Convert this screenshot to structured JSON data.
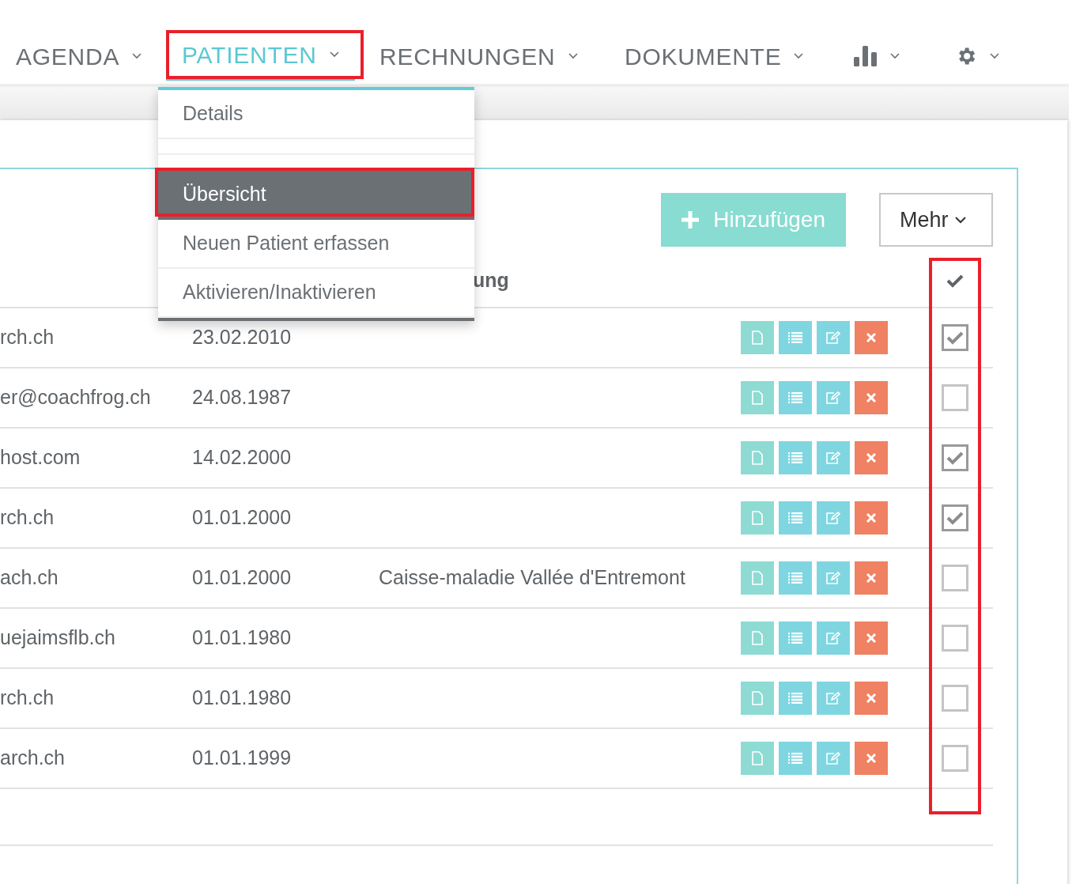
{
  "nav": [
    {
      "kind": "text",
      "label": "AGENDA",
      "selected": false,
      "highlighted": false
    },
    {
      "kind": "text",
      "label": "PATIENTEN",
      "selected": true,
      "highlighted": true
    },
    {
      "kind": "text",
      "label": "RECHNUNGEN",
      "selected": false,
      "highlighted": false
    },
    {
      "kind": "text",
      "label": "DOKUMENTE",
      "selected": false,
      "highlighted": false
    },
    {
      "kind": "chart",
      "selected": false,
      "highlighted": false
    },
    {
      "kind": "gear",
      "selected": false,
      "highlighted": false
    }
  ],
  "dropdown": {
    "items": [
      {
        "kind": "item",
        "label": "Details",
        "selected": false,
        "highlighted": false
      },
      {
        "kind": "blank",
        "selected": false,
        "highlighted": false
      },
      {
        "kind": "blank",
        "selected": false,
        "highlighted": false
      },
      {
        "kind": "item",
        "label": "Übersicht",
        "selected": true,
        "highlighted": true
      },
      {
        "kind": "item",
        "label": "Neuen Patient erfassen",
        "selected": false,
        "highlighted": false
      },
      {
        "kind": "item",
        "label": "Aktivieren/Inaktivieren",
        "selected": false,
        "highlighted": false
      }
    ]
  },
  "toolbar": {
    "add_button": "Hinzufügen",
    "more_button": "Mehr"
  },
  "table": {
    "column_3_header": "ung",
    "checkbox_column_highlighted": true,
    "rows": [
      {
        "column_1": "rch.ch",
        "date": "23.02.2010",
        "column_3": "",
        "checked": true
      },
      {
        "column_1": "er@coachfrog.ch",
        "date": "24.08.1987",
        "column_3": "",
        "checked": false
      },
      {
        "column_1": "host.com",
        "date": "14.02.2000",
        "column_3": "",
        "checked": true
      },
      {
        "column_1": "rch.ch",
        "date": "01.01.2000",
        "column_3": "",
        "checked": true
      },
      {
        "column_1": "ach.ch",
        "date": "01.01.2000",
        "column_3": "Caisse-maladie Vallée d'Entremont",
        "checked": false
      },
      {
        "column_1": "uejaimsflb.ch",
        "date": "01.01.1980",
        "column_3": "",
        "checked": false
      },
      {
        "column_1": "rch.ch",
        "date": "01.01.1980",
        "column_3": "",
        "checked": false
      },
      {
        "column_1": "arch.ch",
        "date": "01.01.1999",
        "column_3": "",
        "checked": false
      }
    ]
  }
}
